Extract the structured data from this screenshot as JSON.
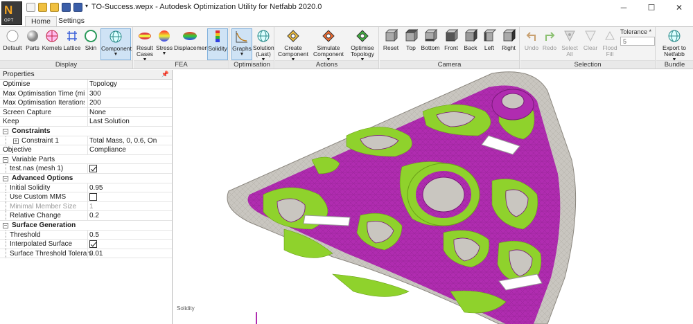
{
  "window": {
    "title": "TO-Success.wepx - Autodesk Optimization Utility for Netfabb 2020.0",
    "logo_label": "OPT"
  },
  "tabs": [
    {
      "label": "Home",
      "active": true
    },
    {
      "label": "Settings",
      "active": false
    }
  ],
  "ribbon": {
    "groups": [
      {
        "title": "Display",
        "buttons": [
          "Default",
          "Parts",
          "Kernels",
          "Lattice",
          "Skin",
          "Component"
        ]
      },
      {
        "title": "FEA",
        "buttons": [
          "Result Cases",
          "Stress",
          "Displacement",
          "Solidity"
        ]
      },
      {
        "title": "Optimisation",
        "buttons": [
          "Graphs",
          "Solution (Last)"
        ]
      },
      {
        "title": "Actions",
        "buttons": [
          "Create Component",
          "Simulate Component",
          "Optimise Topology"
        ]
      },
      {
        "title": "Camera",
        "buttons": [
          "Reset",
          "Top",
          "Bottom",
          "Front",
          "Back",
          "Left",
          "Right"
        ]
      },
      {
        "title": "Selection",
        "buttons": [
          "Undo",
          "Redo",
          "Select All",
          "Clear",
          "Flood Fill"
        ]
      },
      {
        "title": "Bundle",
        "buttons": [
          "Export to Netfabb"
        ]
      }
    ],
    "tolerance_label": "Tolerance *",
    "tolerance_value": "5"
  },
  "properties": {
    "title": "Properties",
    "rows": [
      {
        "key": "Optimise",
        "value": "Topology"
      },
      {
        "key": "Max Optimisation Time (mins)",
        "value": "300"
      },
      {
        "key": "Max Optimisation Iterations",
        "value": "200"
      },
      {
        "key": "Screen Capture",
        "value": "None"
      },
      {
        "key": "Keep",
        "value": "Last Solution"
      },
      {
        "key": "Constraints",
        "value": ""
      },
      {
        "key": "Constraint 1",
        "value": "Total Mass, 0, 0.6, On"
      },
      {
        "key": "Objective",
        "value": "Compliance"
      },
      {
        "key": "Variable Parts",
        "value": ""
      },
      {
        "key": "test.nas (mesh 1)",
        "value": ""
      },
      {
        "key": "Advanced Options",
        "value": ""
      },
      {
        "key": "Initial Solidity",
        "value": "0.95"
      },
      {
        "key": "Use Custom MMS",
        "value": ""
      },
      {
        "key": "Minimal Member Size",
        "value": "1"
      },
      {
        "key": "Relative Change",
        "value": "0.2"
      },
      {
        "key": "Surface Generation",
        "value": ""
      },
      {
        "key": "Threshold",
        "value": "0.5"
      },
      {
        "key": "Interpolated Surface",
        "value": ""
      },
      {
        "key": "Surface Threshold Tolerance",
        "value": "0.01"
      }
    ]
  },
  "viewport": {
    "label": "Solidity"
  },
  "colors": {
    "solid_green": "#8fd22c",
    "mesh_magenta": "#b02cb0",
    "void_grey": "#c9c6c0",
    "selection_blue": "#cfe3f5"
  }
}
